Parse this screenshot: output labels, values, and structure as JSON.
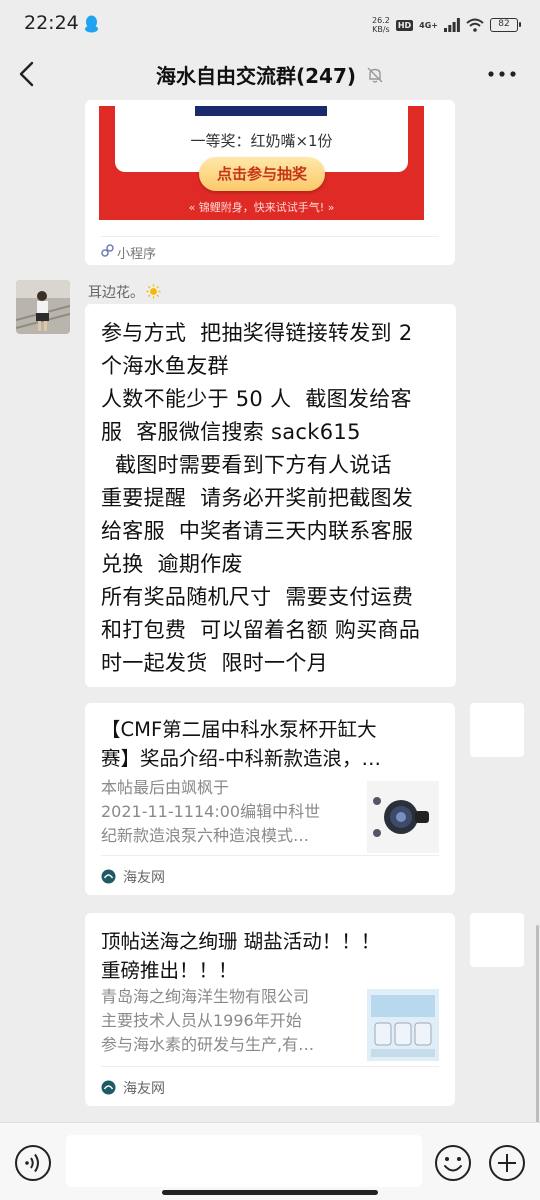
{
  "status_bar": {
    "time": "22:24",
    "net_speed_value": "26.2",
    "net_speed_unit": "KB/s",
    "hd": "HD",
    "network": "4G+",
    "battery": "82"
  },
  "header": {
    "title": "海水自由交流群(247)"
  },
  "mini_program_card": {
    "prize_text": "一等奖：红奶嘴×1份",
    "button_label": "点击参与抽奖",
    "luck_text": "«   锦鲤附身，快来试试手气!   »",
    "footer_label": "小程序"
  },
  "sender": {
    "name": "耳边花。"
  },
  "message": {
    "lines": [
      "参与方式  把抽奖得链接转发到 2",
      "个海水鱼友群",
      "人数不能少于 50 人  截图发给客",
      "服  客服微信搜索 sack615",
      "  截图时需要看到下方有人说话",
      "重要提醒  请务必开奖前把截图发",
      "给客服  中奖者请三天内联系客服",
      "兑换  逾期作废",
      "所有奖品随机尺寸  需要支付运费",
      "和打包费  可以留着名额 购买商品",
      "时一起发货  限时一个月"
    ]
  },
  "link_cards": [
    {
      "title_line1": "【CMF第二届中科水泵杯开缸大",
      "title_line2": "赛】奖品介绍-中科新款造浪，…",
      "desc_line1": "本帖最后由飒枫于",
      "desc_line2": "2021-11-1114:00编辑中科世",
      "desc_line3": "纪新款造浪泵六种造浪模式…",
      "source": "海友网"
    },
    {
      "title_line1": "顶帖送海之绚珊 瑚盐活动！！！",
      "title_line2": "重磅推出！！！",
      "desc_line1": "青岛海之绚海洋生物有限公司",
      "desc_line2": "主要技术人员从1996年开始",
      "desc_line3": "参与海水素的研发与生产,有…",
      "source": "海友网"
    }
  ],
  "icons": {
    "back": "chevron-left-icon",
    "mute": "bell-off-icon",
    "more": "more-dots-icon",
    "voice": "voice-icon",
    "emoji": "emoji-icon",
    "plus": "plus-icon"
  },
  "colors": {
    "background": "#ededed",
    "card_red": "#e02a26",
    "button_gold": "#fcc96a"
  }
}
